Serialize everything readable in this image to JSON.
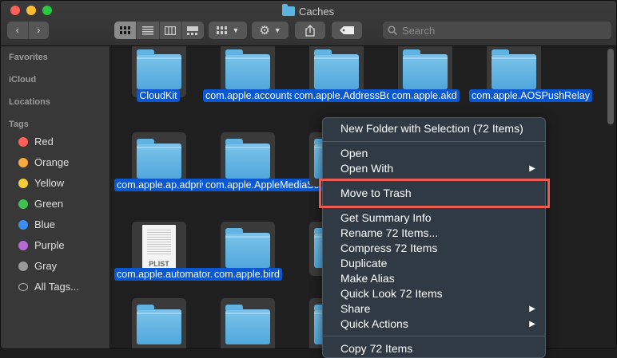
{
  "window": {
    "title": "Caches"
  },
  "toolbar": {
    "back": "‹",
    "forward": "›",
    "search_placeholder": "Search"
  },
  "sidebar": {
    "favorites": "Favorites",
    "icloud": "iCloud",
    "locations": "Locations",
    "tags_header": "Tags",
    "tags": [
      {
        "label": "Red",
        "color": "#fe5f57"
      },
      {
        "label": "Orange",
        "color": "#f8a83c"
      },
      {
        "label": "Yellow",
        "color": "#f4cf3a"
      },
      {
        "label": "Green",
        "color": "#3fc24f"
      },
      {
        "label": "Blue",
        "color": "#3a8ef2"
      },
      {
        "label": "Purple",
        "color": "#b66ad6"
      },
      {
        "label": "Gray",
        "color": "#9a9a9a"
      },
      {
        "label": "All Tags...",
        "color": ""
      }
    ]
  },
  "files": [
    {
      "name": "CloudKit",
      "kind": "folder"
    },
    {
      "name": "com.apple.accountsd",
      "kind": "folder"
    },
    {
      "name": "com.apple.AddressBookSourceSync",
      "kind": "folder"
    },
    {
      "name": "com.apple.akd",
      "kind": "folder"
    },
    {
      "name": "com.apple.AOSPushRelay",
      "kind": "folder"
    },
    {
      "name": "com.apple.ap.adprivacyd",
      "kind": "folder"
    },
    {
      "name": "com.apple.AppleMediaServices",
      "kind": "folder"
    },
    {
      "name": "com.apple.automator.acti...ons.plist",
      "kind": "plist",
      "badge": "PLIST"
    },
    {
      "name": "com.apple.bird",
      "kind": "folder"
    }
  ],
  "context_menu": {
    "items": [
      {
        "label": "New Folder with Selection (72 Items)"
      },
      {
        "label": "Open"
      },
      {
        "label": "Open With",
        "submenu": "▶"
      },
      {
        "label": "Move to Trash",
        "highlighted": true
      },
      {
        "label": "Get Summary Info"
      },
      {
        "label": "Rename 72 Items..."
      },
      {
        "label": "Compress 72 Items"
      },
      {
        "label": "Duplicate"
      },
      {
        "label": "Make Alias"
      },
      {
        "label": "Quick Look 72 Items"
      },
      {
        "label": "Share",
        "submenu": "▶"
      },
      {
        "label": "Quick Actions",
        "submenu": "▶"
      },
      {
        "label": "Copy 72 Items"
      }
    ]
  },
  "colors": {
    "selection": "#0b57d0",
    "folder": "#5db3e0",
    "highlight_box": "#ec5a52"
  }
}
